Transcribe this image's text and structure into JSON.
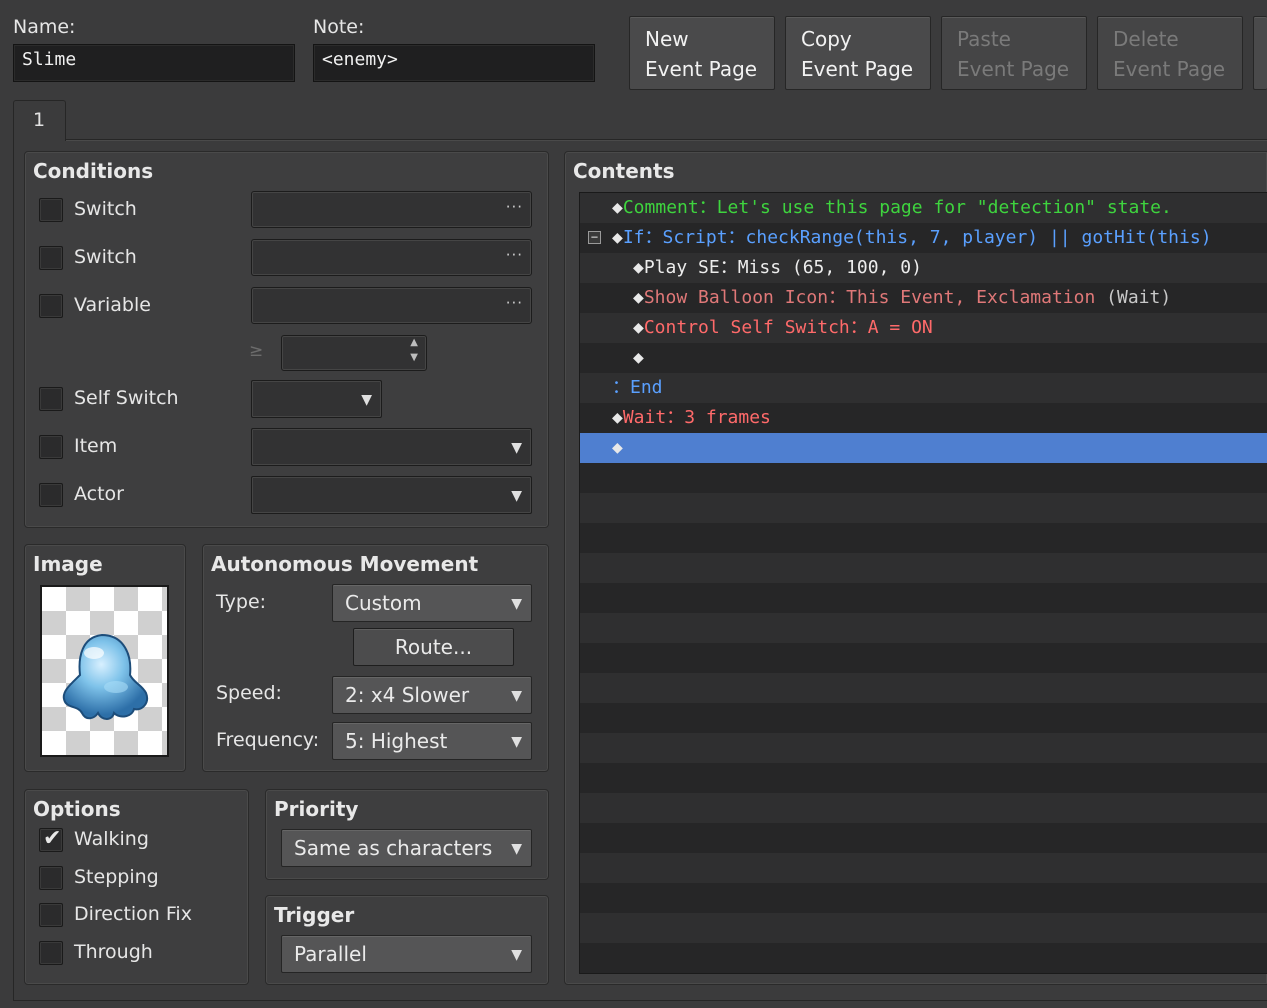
{
  "header": {
    "name_label": "Name:",
    "name_value": "Slime",
    "note_label": "Note:",
    "note_value": "<enemy>",
    "buttons": [
      {
        "line1": "New",
        "line2": "Event Page",
        "enabled": true
      },
      {
        "line1": "Copy",
        "line2": "Event Page",
        "enabled": true
      },
      {
        "line1": "Paste",
        "line2": "Event Page",
        "enabled": false
      },
      {
        "line1": "Delete",
        "line2": "Event Page",
        "enabled": false
      }
    ]
  },
  "tabs": [
    {
      "label": "1"
    }
  ],
  "conditions": {
    "title": "Conditions",
    "switch1": "Switch",
    "switch2": "Switch",
    "variable": "Variable",
    "ge_symbol": "≥",
    "self_switch": "Self Switch",
    "item": "Item",
    "actor": "Actor",
    "dots": "···"
  },
  "image": {
    "title": "Image",
    "sprite": "slime-sprite"
  },
  "movement": {
    "title": "Autonomous Movement",
    "type_label": "Type:",
    "type_value": "Custom",
    "route_button": "Route...",
    "speed_label": "Speed:",
    "speed_value": "2: x4 Slower",
    "frequency_label": "Frequency:",
    "frequency_value": "5: Highest"
  },
  "options": {
    "title": "Options",
    "walking": "Walking",
    "walking_checked": true,
    "stepping": "Stepping",
    "direction_fix": "Direction Fix",
    "through": "Through"
  },
  "priority": {
    "title": "Priority",
    "value": "Same as characters"
  },
  "trigger": {
    "title": "Trigger",
    "value": "Parallel"
  },
  "contents": {
    "title": "Contents",
    "rows": [
      {
        "indent": 0,
        "prefix": "◆",
        "parts": [
          {
            "text": "Comment：Let's use this page for \"detection\" state.",
            "color": "green"
          }
        ]
      },
      {
        "indent": 0,
        "prefix": "◆",
        "collapse": "−",
        "parts": [
          {
            "text": "If：Script：checkRange(this, 7, player) || gotHit(this)",
            "color": "blue"
          }
        ]
      },
      {
        "indent": 1,
        "prefix": "◆",
        "parts": [
          {
            "text": "Play SE：Miss (65, 100, 0)",
            "color": "white"
          }
        ]
      },
      {
        "indent": 1,
        "prefix": "◆",
        "parts": [
          {
            "text": "Show Balloon Icon：This Event, Exclamation",
            "color": "pink"
          },
          {
            "text": " (Wait)",
            "color": "gray"
          }
        ]
      },
      {
        "indent": 1,
        "prefix": "◆",
        "parts": [
          {
            "text": "Control Self Switch：A = ON",
            "color": "red"
          }
        ]
      },
      {
        "indent": 1,
        "prefix": "◆",
        "parts": []
      },
      {
        "indent": 0,
        "prefix": "：",
        "parts": [
          {
            "text": "End",
            "color": "blue"
          }
        ]
      },
      {
        "indent": 0,
        "prefix": "◆",
        "parts": [
          {
            "text": "Wait：3 frames",
            "color": "red"
          }
        ]
      },
      {
        "indent": 0,
        "prefix": "◆",
        "parts": [],
        "selected": true
      }
    ]
  }
}
